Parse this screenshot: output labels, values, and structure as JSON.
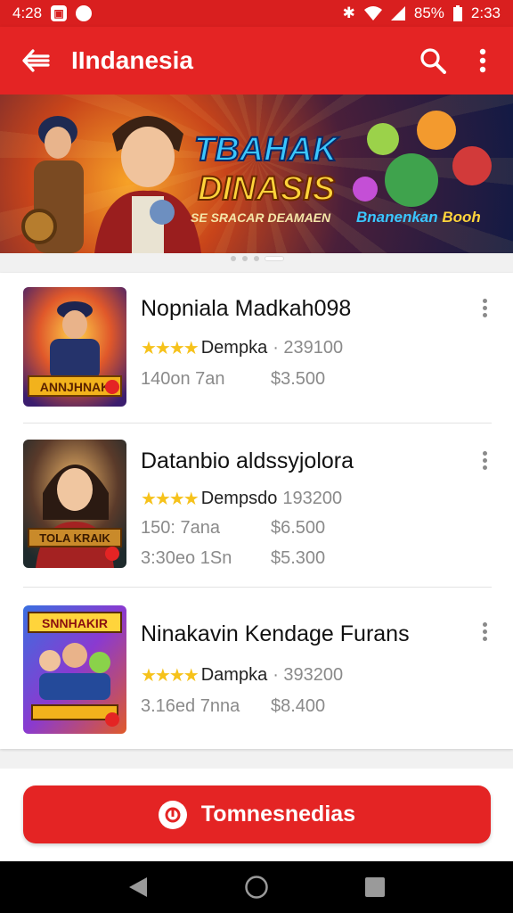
{
  "status_bar": {
    "time_left": "4:28",
    "battery": "85%",
    "time_right": "2:33"
  },
  "app_bar": {
    "title": "IIndanesia"
  },
  "banner": {
    "title_line1": "TBAHAK",
    "title_line2": "DINASIS",
    "subtitle": "SE SRACAR DEAMAEN",
    "badge_part1": "Bnanenkan ",
    "badge_part2": "Booh"
  },
  "apps": [
    {
      "name": "Nopniala Madkah098",
      "stars": "★★★★",
      "developer": "Dempka",
      "downloads": "· 239100",
      "meta": [
        "140on 7an"
      ],
      "prices": [
        "$3.500"
      ],
      "thumb_label": "ANNJHNAK"
    },
    {
      "name": "Datanbio aldssyjolora",
      "stars": "★★★★",
      "developer": "Dempsdo",
      "downloads": "193200",
      "meta": [
        "150: 7ana",
        "3:30eo 1Sn"
      ],
      "prices": [
        "$6.500",
        "$5.300"
      ],
      "thumb_label": "TOLA KRAIK"
    },
    {
      "name": "Ninakavin Kendage Furans",
      "stars": "★★★★",
      "developer": "Dampka",
      "downloads": "· 393200",
      "meta": [
        "3.16ed 7nna"
      ],
      "prices": [
        "$8.400"
      ],
      "thumb_label": "SNNHAKIR"
    }
  ],
  "cta": {
    "label": "Tomnesnedias"
  },
  "colors": {
    "primary": "#e42424",
    "status_bar": "#d91f1f",
    "star": "#f6c21b"
  }
}
